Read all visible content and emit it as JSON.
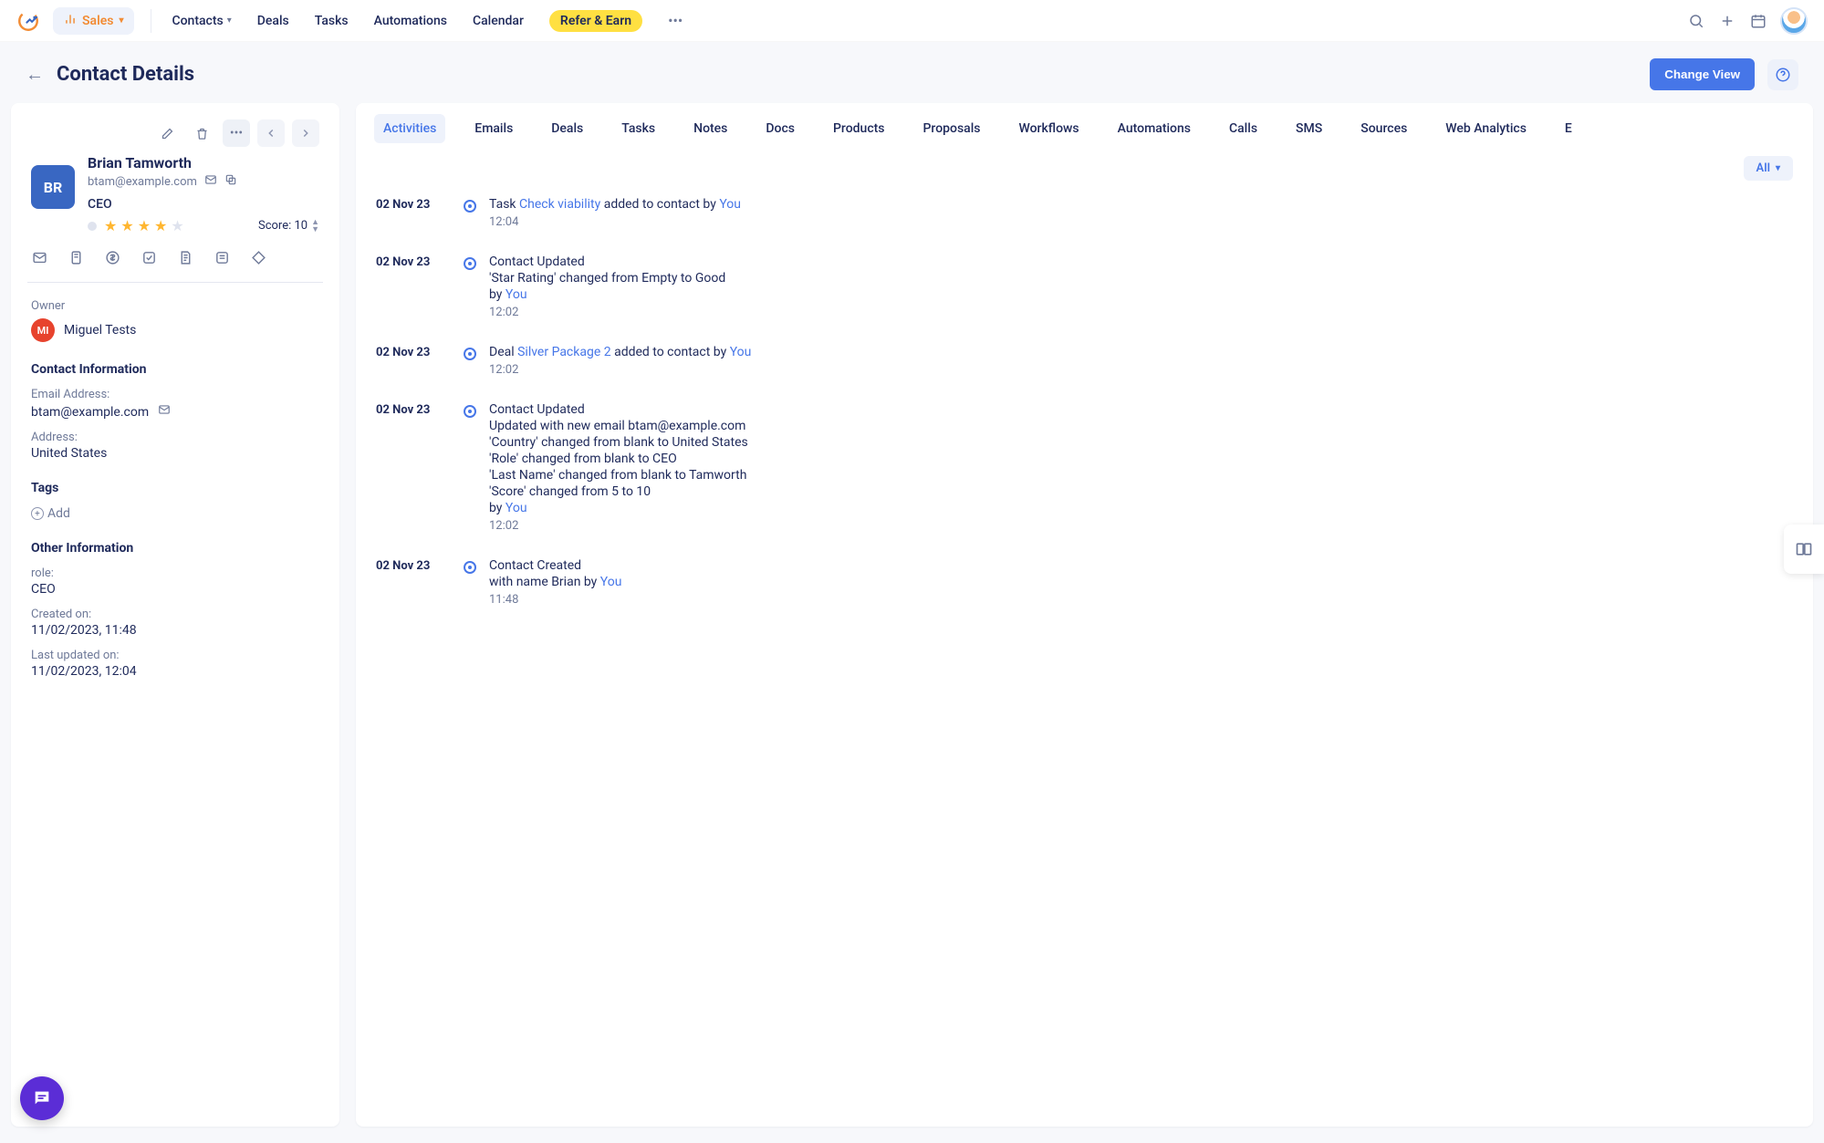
{
  "nav": {
    "module": "Sales",
    "links": [
      "Contacts",
      "Deals",
      "Tasks",
      "Automations",
      "Calendar"
    ],
    "refer": "Refer & Earn"
  },
  "header": {
    "title": "Contact Details",
    "change_view": "Change View"
  },
  "contact": {
    "initials": "BR",
    "name": "Brian Tamworth",
    "email": "btam@example.com",
    "title": "CEO",
    "stars_filled": 4,
    "stars_total": 5,
    "score_label": "Score: 10"
  },
  "owner": {
    "label": "Owner",
    "initials": "MI",
    "name": "Miguel Tests"
  },
  "info": {
    "section": "Contact Information",
    "email_label": "Email Address:",
    "email_value": "btam@example.com",
    "address_label": "Address:",
    "address_value": "United States"
  },
  "tags": {
    "section": "Tags",
    "add": "Add"
  },
  "other": {
    "section": "Other Information",
    "role_label": "role:",
    "role_value": "CEO",
    "created_label": "Created on:",
    "created_value": "11/02/2023, 11:48",
    "updated_label": "Last updated on:",
    "updated_value": "11/02/2023, 12:04"
  },
  "tabs": [
    "Activities",
    "Emails",
    "Deals",
    "Tasks",
    "Notes",
    "Docs",
    "Products",
    "Proposals",
    "Workflows",
    "Automations",
    "Calls",
    "SMS",
    "Sources",
    "Web Analytics",
    "E"
  ],
  "filter": "All",
  "timeline": [
    {
      "date": "02 Nov 23",
      "time": "12:04",
      "text_pre": "Task ",
      "link": "Check viability",
      "text_mid": " added to contact by ",
      "by": "You"
    },
    {
      "date": "02 Nov 23",
      "time": "12:02",
      "lines": [
        "Contact Updated",
        "'Star Rating' changed from Empty to Good"
      ],
      "by_prefix": "by ",
      "by": "You"
    },
    {
      "date": "02 Nov 23",
      "time": "12:02",
      "text_pre": "Deal ",
      "link": "Silver Package 2",
      "text_mid": " added to contact by ",
      "by": "You"
    },
    {
      "date": "02 Nov 23",
      "time": "12:02",
      "lines": [
        "Contact Updated",
        "Updated with new email btam@example.com",
        "'Country' changed from blank to United States",
        "'Role' changed from blank to CEO",
        "'Last Name' changed from blank to Tamworth",
        "'Score' changed from 5 to 10"
      ],
      "by_prefix": "by ",
      "by": "You"
    },
    {
      "date": "02 Nov 23",
      "time": "11:48",
      "lines": [
        "Contact Created"
      ],
      "text_pre2": "with name Brian by ",
      "by": "You"
    }
  ]
}
